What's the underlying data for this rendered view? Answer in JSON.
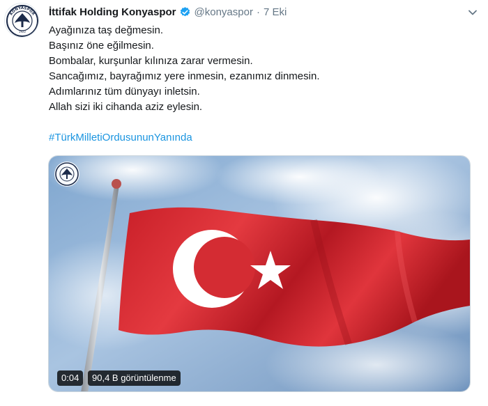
{
  "author": {
    "display_name": "İttifak Holding Konyaspor",
    "handle": "@konyaspor",
    "separator": "·",
    "date": "7 Eki",
    "avatar_icon": "konyaspor-crest-icon",
    "avatar_text": "KONYASPOR",
    "verified_icon": "verified-badge-icon"
  },
  "tweet": {
    "lines": [
      "Ayağınıza taş değmesin.",
      "Başınız öne eğilmesin.",
      "Bombalar, kurşunlar kılınıza zarar vermesin.",
      "Sancağımız, bayrağımız yere inmesin, ezanımız dinmesin.",
      "Adımlarınız tüm dünyayı inletsin.",
      "Allah sizi iki cihanda aziz eylesin."
    ],
    "hashtag": "#TürkMilletiOrdusununYanında"
  },
  "media": {
    "type": "video",
    "duration": "0:04",
    "views": "90,4 B görüntülenme",
    "overlay_logo_icon": "konyaspor-crest-icon"
  },
  "colors": {
    "accent": "#1da1f2",
    "link": "#1b95e0",
    "flag_red": "#d8262f",
    "secondary_text": "#657786"
  }
}
